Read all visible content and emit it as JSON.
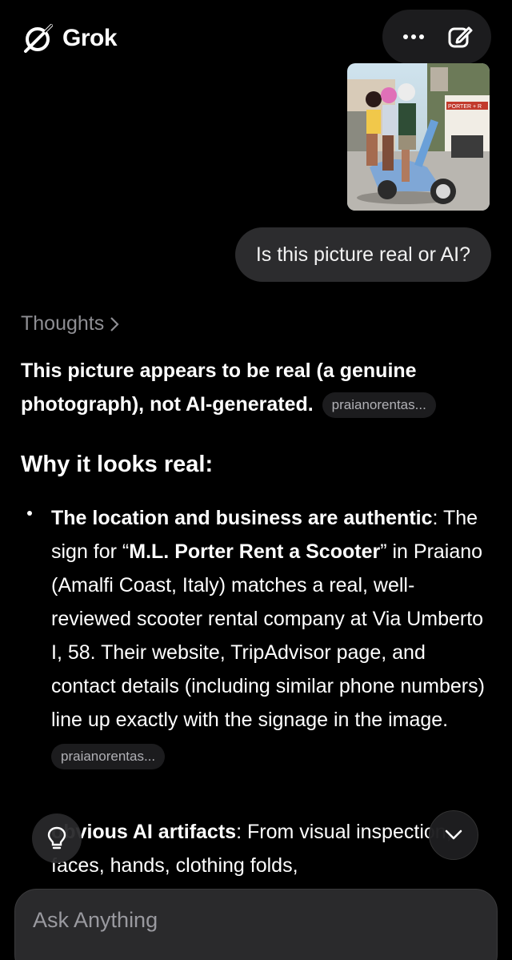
{
  "app": {
    "name": "Grok"
  },
  "user": {
    "question": "Is this picture real or AI?",
    "image_sign_text": "PORTER + R"
  },
  "thoughts_label": "Thoughts",
  "answer": {
    "summary": "This picture appears to be real (a genuine photograph), not AI-generated.",
    "source_chip_1": "praianorentas...",
    "heading": "Why it looks real:",
    "bullet1": {
      "bold_lead": "The location and business are authentic",
      "text_a": ": The sign for “",
      "bold_name": "M.L. Porter Rent a Scooter",
      "text_b": "” in Praiano (Amalfi Coast, Italy) matches a real, well-reviewed scooter rental company at Via Umberto I, 58. Their website, TripAdvisor page, and contact details (including similar phone numbers) line up exactly with the signage in the image.",
      "chip": "praianorentas..."
    },
    "bullet2": {
      "bold_lead": "obvious AI artifacts",
      "text": ": From visual inspection, faces, hands, clothing folds,"
    }
  },
  "composer": {
    "placeholder": "Ask Anything"
  },
  "colors": {
    "background": "#000000",
    "bubble": "#2c2c2e",
    "chip": "#1c1c1e",
    "muted_text": "#8e8e93"
  }
}
